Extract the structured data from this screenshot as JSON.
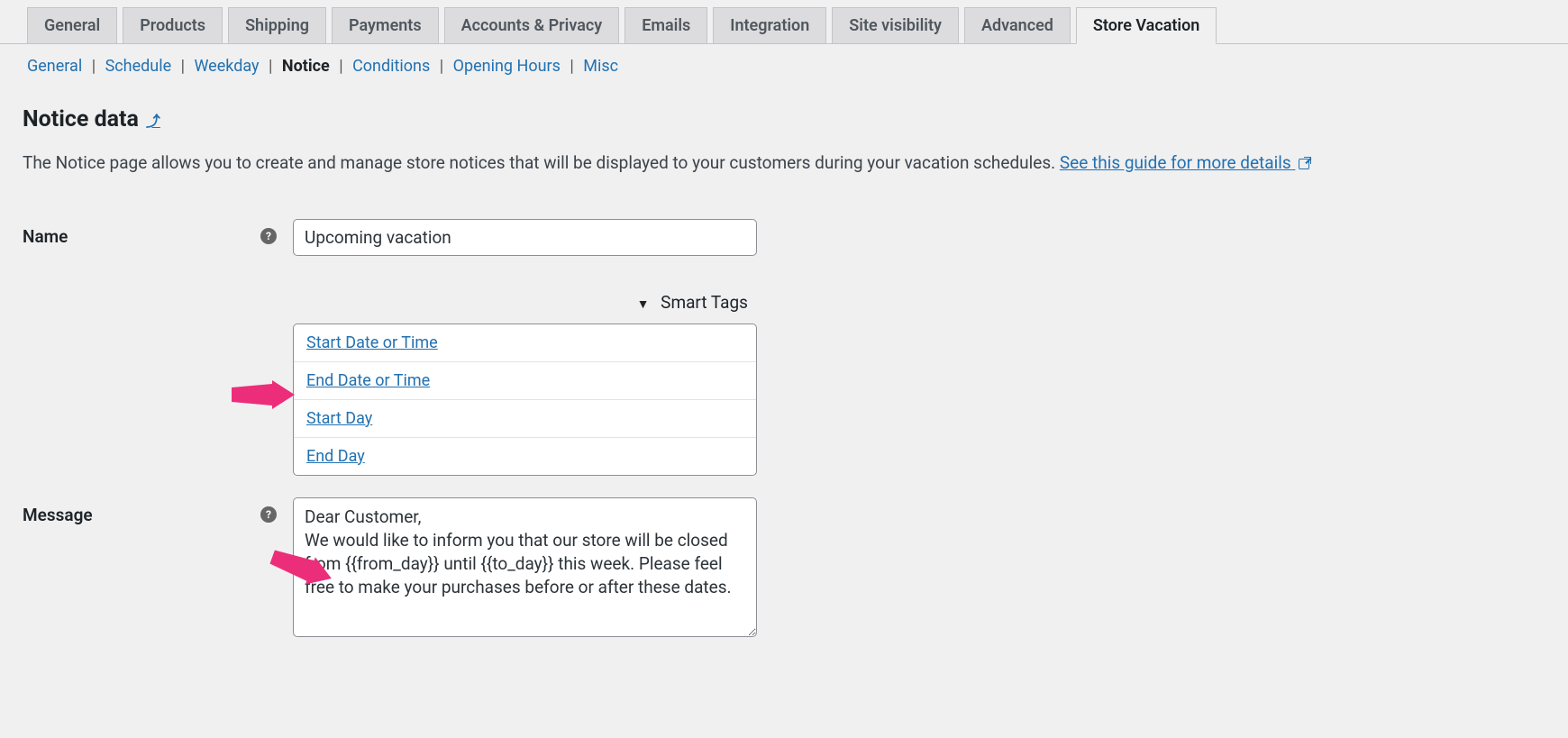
{
  "tabs": {
    "general": "General",
    "products": "Products",
    "shipping": "Shipping",
    "payments": "Payments",
    "accounts": "Accounts & Privacy",
    "emails": "Emails",
    "integration": "Integration",
    "visibility": "Site visibility",
    "advanced": "Advanced",
    "store_vacation": "Store Vacation"
  },
  "subtabs": {
    "general": "General",
    "schedule": "Schedule",
    "weekday": "Weekday",
    "notice": "Notice",
    "conditions": "Conditions",
    "opening_hours": "Opening Hours",
    "misc": "Misc"
  },
  "section": {
    "title": "Notice data",
    "toggle_glyph": "⤴",
    "description_prefix": "The Notice page allows you to create and manage store notices that will be displayed to your customers during your vacation schedules. ",
    "guide_link_text": "See this guide for more details"
  },
  "fields": {
    "name_label": "Name",
    "name_value": "Upcoming vacation",
    "message_label": "Message",
    "message_value": "Dear Customer,\nWe would like to inform you that our store will be closed from {{from_day}} until {{to_day}} this week. Please feel free to make your purchases before or after these dates."
  },
  "smart_tags": {
    "header": "Smart Tags",
    "items": [
      "Start Date or Time",
      "End Date or Time",
      "Start Day",
      "End Day"
    ]
  }
}
